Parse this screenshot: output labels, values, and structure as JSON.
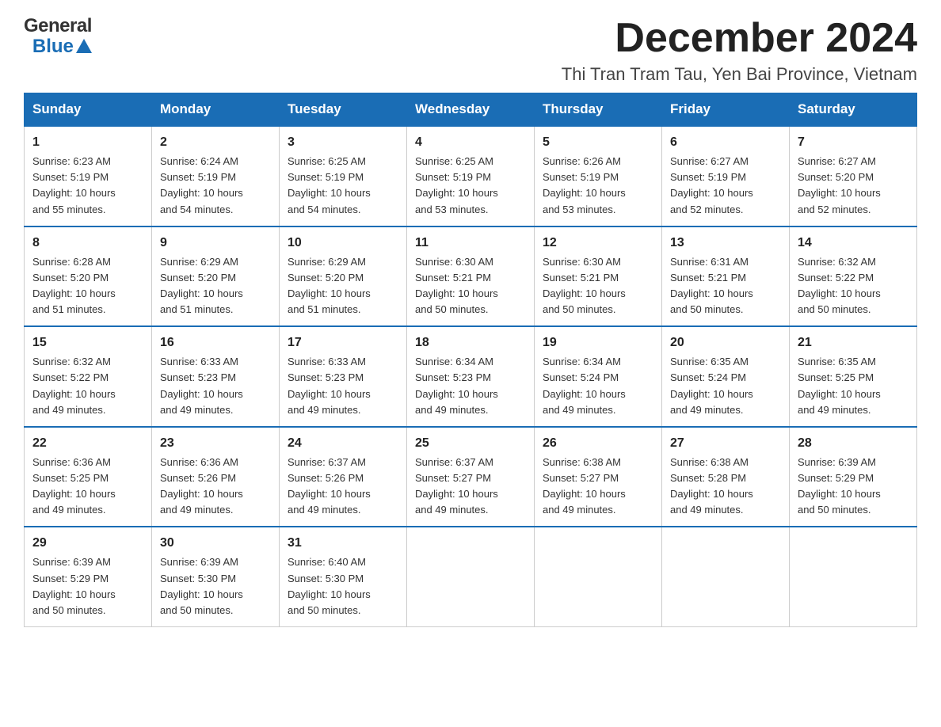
{
  "logo": {
    "text_general": "General",
    "text_blue": "Blue"
  },
  "title": "December 2024",
  "location": "Thi Tran Tram Tau, Yen Bai Province, Vietnam",
  "days_of_week": [
    "Sunday",
    "Monday",
    "Tuesday",
    "Wednesday",
    "Thursday",
    "Friday",
    "Saturday"
  ],
  "weeks": [
    [
      {
        "day": "1",
        "sunrise": "6:23 AM",
        "sunset": "5:19 PM",
        "daylight": "10 hours and 55 minutes."
      },
      {
        "day": "2",
        "sunrise": "6:24 AM",
        "sunset": "5:19 PM",
        "daylight": "10 hours and 54 minutes."
      },
      {
        "day": "3",
        "sunrise": "6:25 AM",
        "sunset": "5:19 PM",
        "daylight": "10 hours and 54 minutes."
      },
      {
        "day": "4",
        "sunrise": "6:25 AM",
        "sunset": "5:19 PM",
        "daylight": "10 hours and 53 minutes."
      },
      {
        "day": "5",
        "sunrise": "6:26 AM",
        "sunset": "5:19 PM",
        "daylight": "10 hours and 53 minutes."
      },
      {
        "day": "6",
        "sunrise": "6:27 AM",
        "sunset": "5:19 PM",
        "daylight": "10 hours and 52 minutes."
      },
      {
        "day": "7",
        "sunrise": "6:27 AM",
        "sunset": "5:20 PM",
        "daylight": "10 hours and 52 minutes."
      }
    ],
    [
      {
        "day": "8",
        "sunrise": "6:28 AM",
        "sunset": "5:20 PM",
        "daylight": "10 hours and 51 minutes."
      },
      {
        "day": "9",
        "sunrise": "6:29 AM",
        "sunset": "5:20 PM",
        "daylight": "10 hours and 51 minutes."
      },
      {
        "day": "10",
        "sunrise": "6:29 AM",
        "sunset": "5:20 PM",
        "daylight": "10 hours and 51 minutes."
      },
      {
        "day": "11",
        "sunrise": "6:30 AM",
        "sunset": "5:21 PM",
        "daylight": "10 hours and 50 minutes."
      },
      {
        "day": "12",
        "sunrise": "6:30 AM",
        "sunset": "5:21 PM",
        "daylight": "10 hours and 50 minutes."
      },
      {
        "day": "13",
        "sunrise": "6:31 AM",
        "sunset": "5:21 PM",
        "daylight": "10 hours and 50 minutes."
      },
      {
        "day": "14",
        "sunrise": "6:32 AM",
        "sunset": "5:22 PM",
        "daylight": "10 hours and 50 minutes."
      }
    ],
    [
      {
        "day": "15",
        "sunrise": "6:32 AM",
        "sunset": "5:22 PM",
        "daylight": "10 hours and 49 minutes."
      },
      {
        "day": "16",
        "sunrise": "6:33 AM",
        "sunset": "5:23 PM",
        "daylight": "10 hours and 49 minutes."
      },
      {
        "day": "17",
        "sunrise": "6:33 AM",
        "sunset": "5:23 PM",
        "daylight": "10 hours and 49 minutes."
      },
      {
        "day": "18",
        "sunrise": "6:34 AM",
        "sunset": "5:23 PM",
        "daylight": "10 hours and 49 minutes."
      },
      {
        "day": "19",
        "sunrise": "6:34 AM",
        "sunset": "5:24 PM",
        "daylight": "10 hours and 49 minutes."
      },
      {
        "day": "20",
        "sunrise": "6:35 AM",
        "sunset": "5:24 PM",
        "daylight": "10 hours and 49 minutes."
      },
      {
        "day": "21",
        "sunrise": "6:35 AM",
        "sunset": "5:25 PM",
        "daylight": "10 hours and 49 minutes."
      }
    ],
    [
      {
        "day": "22",
        "sunrise": "6:36 AM",
        "sunset": "5:25 PM",
        "daylight": "10 hours and 49 minutes."
      },
      {
        "day": "23",
        "sunrise": "6:36 AM",
        "sunset": "5:26 PM",
        "daylight": "10 hours and 49 minutes."
      },
      {
        "day": "24",
        "sunrise": "6:37 AM",
        "sunset": "5:26 PM",
        "daylight": "10 hours and 49 minutes."
      },
      {
        "day": "25",
        "sunrise": "6:37 AM",
        "sunset": "5:27 PM",
        "daylight": "10 hours and 49 minutes."
      },
      {
        "day": "26",
        "sunrise": "6:38 AM",
        "sunset": "5:27 PM",
        "daylight": "10 hours and 49 minutes."
      },
      {
        "day": "27",
        "sunrise": "6:38 AM",
        "sunset": "5:28 PM",
        "daylight": "10 hours and 49 minutes."
      },
      {
        "day": "28",
        "sunrise": "6:39 AM",
        "sunset": "5:29 PM",
        "daylight": "10 hours and 50 minutes."
      }
    ],
    [
      {
        "day": "29",
        "sunrise": "6:39 AM",
        "sunset": "5:29 PM",
        "daylight": "10 hours and 50 minutes."
      },
      {
        "day": "30",
        "sunrise": "6:39 AM",
        "sunset": "5:30 PM",
        "daylight": "10 hours and 50 minutes."
      },
      {
        "day": "31",
        "sunrise": "6:40 AM",
        "sunset": "5:30 PM",
        "daylight": "10 hours and 50 minutes."
      },
      null,
      null,
      null,
      null
    ]
  ],
  "labels": {
    "sunrise": "Sunrise:",
    "sunset": "Sunset:",
    "daylight": "Daylight:"
  }
}
